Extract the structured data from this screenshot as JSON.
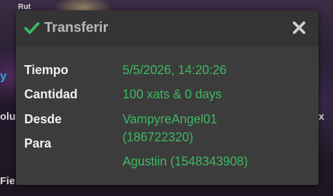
{
  "background": {
    "fragments": [
      "y",
      "olu",
      "Fie",
      "x",
      "Rut"
    ]
  },
  "dialog": {
    "title": "Transferir",
    "icons": {
      "status": "check-icon",
      "close": "close-icon"
    },
    "labels": {
      "time": "Tiempo",
      "amount": "Cantidad",
      "from": "Desde",
      "to": "Para"
    },
    "values": {
      "time": "5/5/2026, 14:20:26",
      "amount": "100 xats & 0 days",
      "from_line1": "VampyreAngel01",
      "from_line2": "(186722320)",
      "to": "Agustiin (1548343908)"
    },
    "colors": {
      "accent_green": "#3cb960",
      "dialog_bg": "#3c3c3c",
      "header_bg": "#343434",
      "title_gray": "#b9b9b9"
    }
  }
}
